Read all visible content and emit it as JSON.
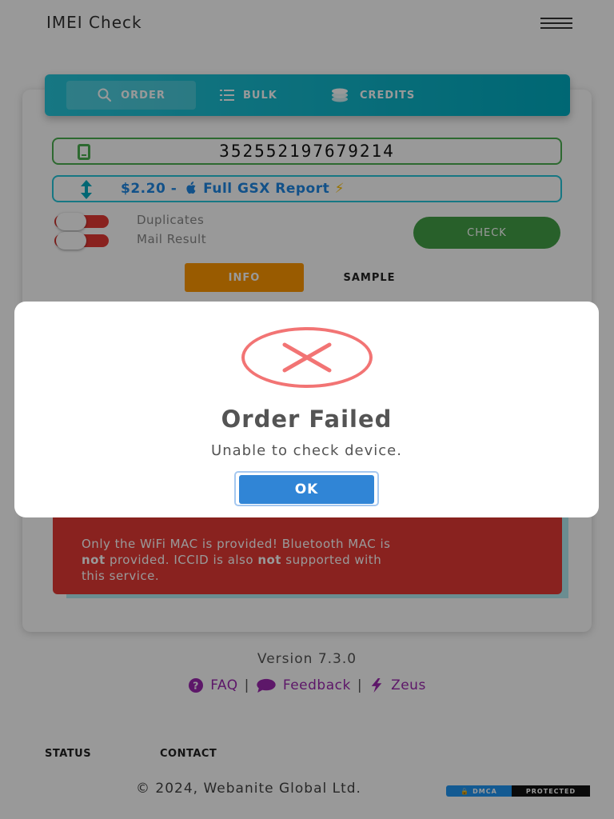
{
  "header": {
    "title": "IMEI Check",
    "menu_icon": "hamburger-icon"
  },
  "tabs": [
    {
      "label": "ORDER",
      "icon": "search-icon",
      "active": true
    },
    {
      "label": "BULK",
      "icon": "list-icon",
      "active": false
    },
    {
      "label": "CREDITS",
      "icon": "coins-icon",
      "active": false
    }
  ],
  "form": {
    "imei_value": "352552197679214",
    "service_text": "$2.20 -  Full GSX Report",
    "service_price": "$2.20 -",
    "service_name": "Full GSX Report",
    "service_emoji": "⚡",
    "toggles": [
      {
        "label": "Duplicates",
        "on": false
      },
      {
        "label": "Mail Result",
        "on": false
      }
    ],
    "check_label": "CHECK",
    "info_label": "INFO",
    "sample_label": "SAMPLE"
  },
  "notice": {
    "line1": "Only the WiFi MAC is provided! Bluetooth MAC is",
    "not1": "not",
    "line2": "provided. ICCID is also",
    "not2": "not",
    "line3": "supported with",
    "line4": "this service."
  },
  "footer": {
    "version": "Version 7.3.0",
    "faq": "FAQ",
    "feedback": "Feedback",
    "zeus": "Zeus",
    "separator": "|",
    "status": "STATUS",
    "contact": "CONTACT",
    "copyright": "© 2024, Webanite Global Ltd.",
    "dmca_left": "DMCA",
    "dmca_right": "PROTECTED"
  },
  "modal": {
    "title": "Order Failed",
    "text": "Unable to check device.",
    "ok_label": "OK",
    "icon": "error-x-icon"
  },
  "colors": {
    "tabs": "#00acc1",
    "imei_border": "#4caf50",
    "service_border": "#26c6da",
    "check": "#43a047",
    "info": "#ff9800",
    "notice": "#e53935",
    "ok": "#3085d6",
    "error": "#f27474",
    "links": "#9c27b0"
  }
}
